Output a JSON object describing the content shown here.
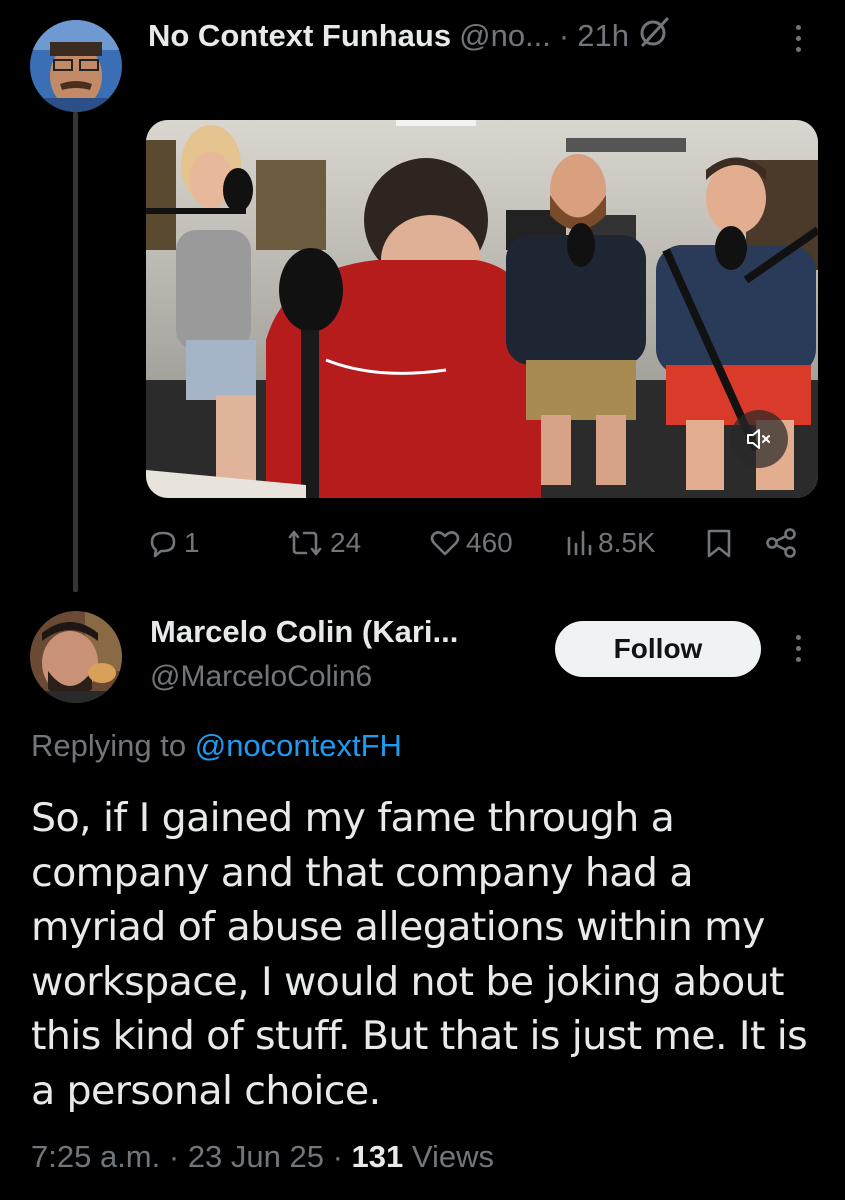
{
  "parent_tweet": {
    "display_name": "No Context Funhaus",
    "handle": "@no...",
    "time": "21h",
    "avatar_icon": "profile-avatar-icon",
    "stats": {
      "replies": "1",
      "reposts": "24",
      "likes": "460",
      "views": "8.5K"
    }
  },
  "reply_tweet": {
    "display_name": "Marcelo Colin (Kari...",
    "handle": "@MarceloColin6",
    "follow_label": "Follow",
    "replying_prefix": "Replying to",
    "replying_to": "@nocontextFH",
    "text_lines": [
      "So, if I gained my fame through a",
      "company and that company had a",
      "myriad of abuse allegations within my",
      "workspace, I would not be joking about",
      "this kind of stuff. But that is just me. It is",
      "a personal choice."
    ],
    "time": "7:25 a.m.",
    "date": "23 Jun 25",
    "views_count": "131",
    "views_label": "Views"
  },
  "colors": {
    "background": "#000000",
    "text_primary": "#e7e9ea",
    "text_secondary": "#71767b",
    "link": "#1d9bf0",
    "follow_bg": "#eff3f4"
  }
}
